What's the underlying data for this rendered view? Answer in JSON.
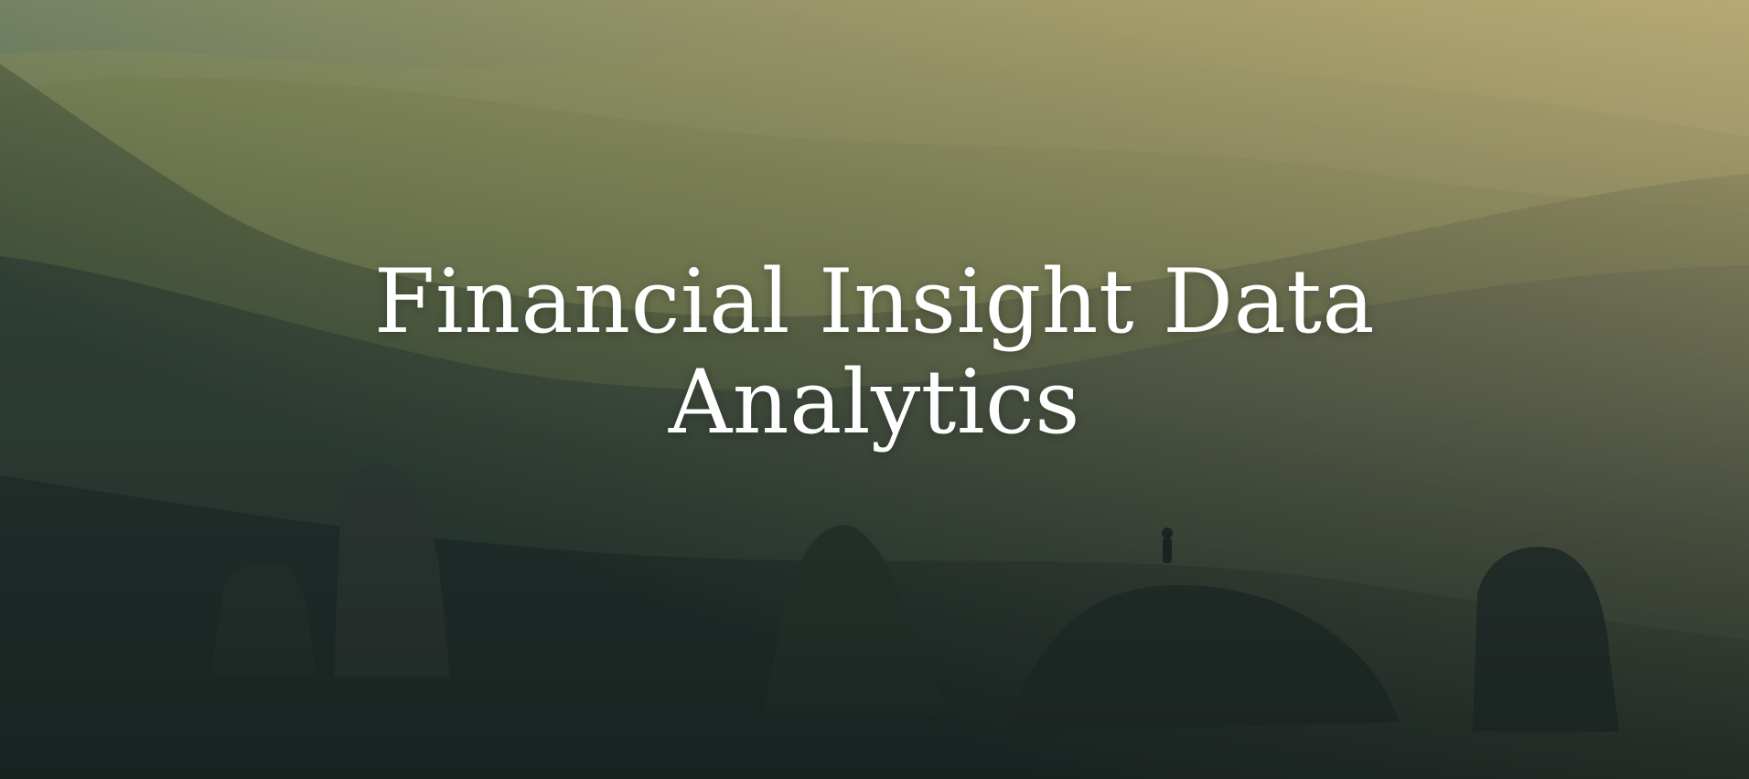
{
  "hero": {
    "title_line_1": "Financial Insight Data",
    "title_line_2": "Analytics",
    "background_image": "mountain-landscape-image",
    "colors": {
      "sky_glow": "#d8c27a",
      "forest_dark": "#1c2a24",
      "overlay": "#1f2a2a",
      "title": "#ffffff"
    }
  }
}
